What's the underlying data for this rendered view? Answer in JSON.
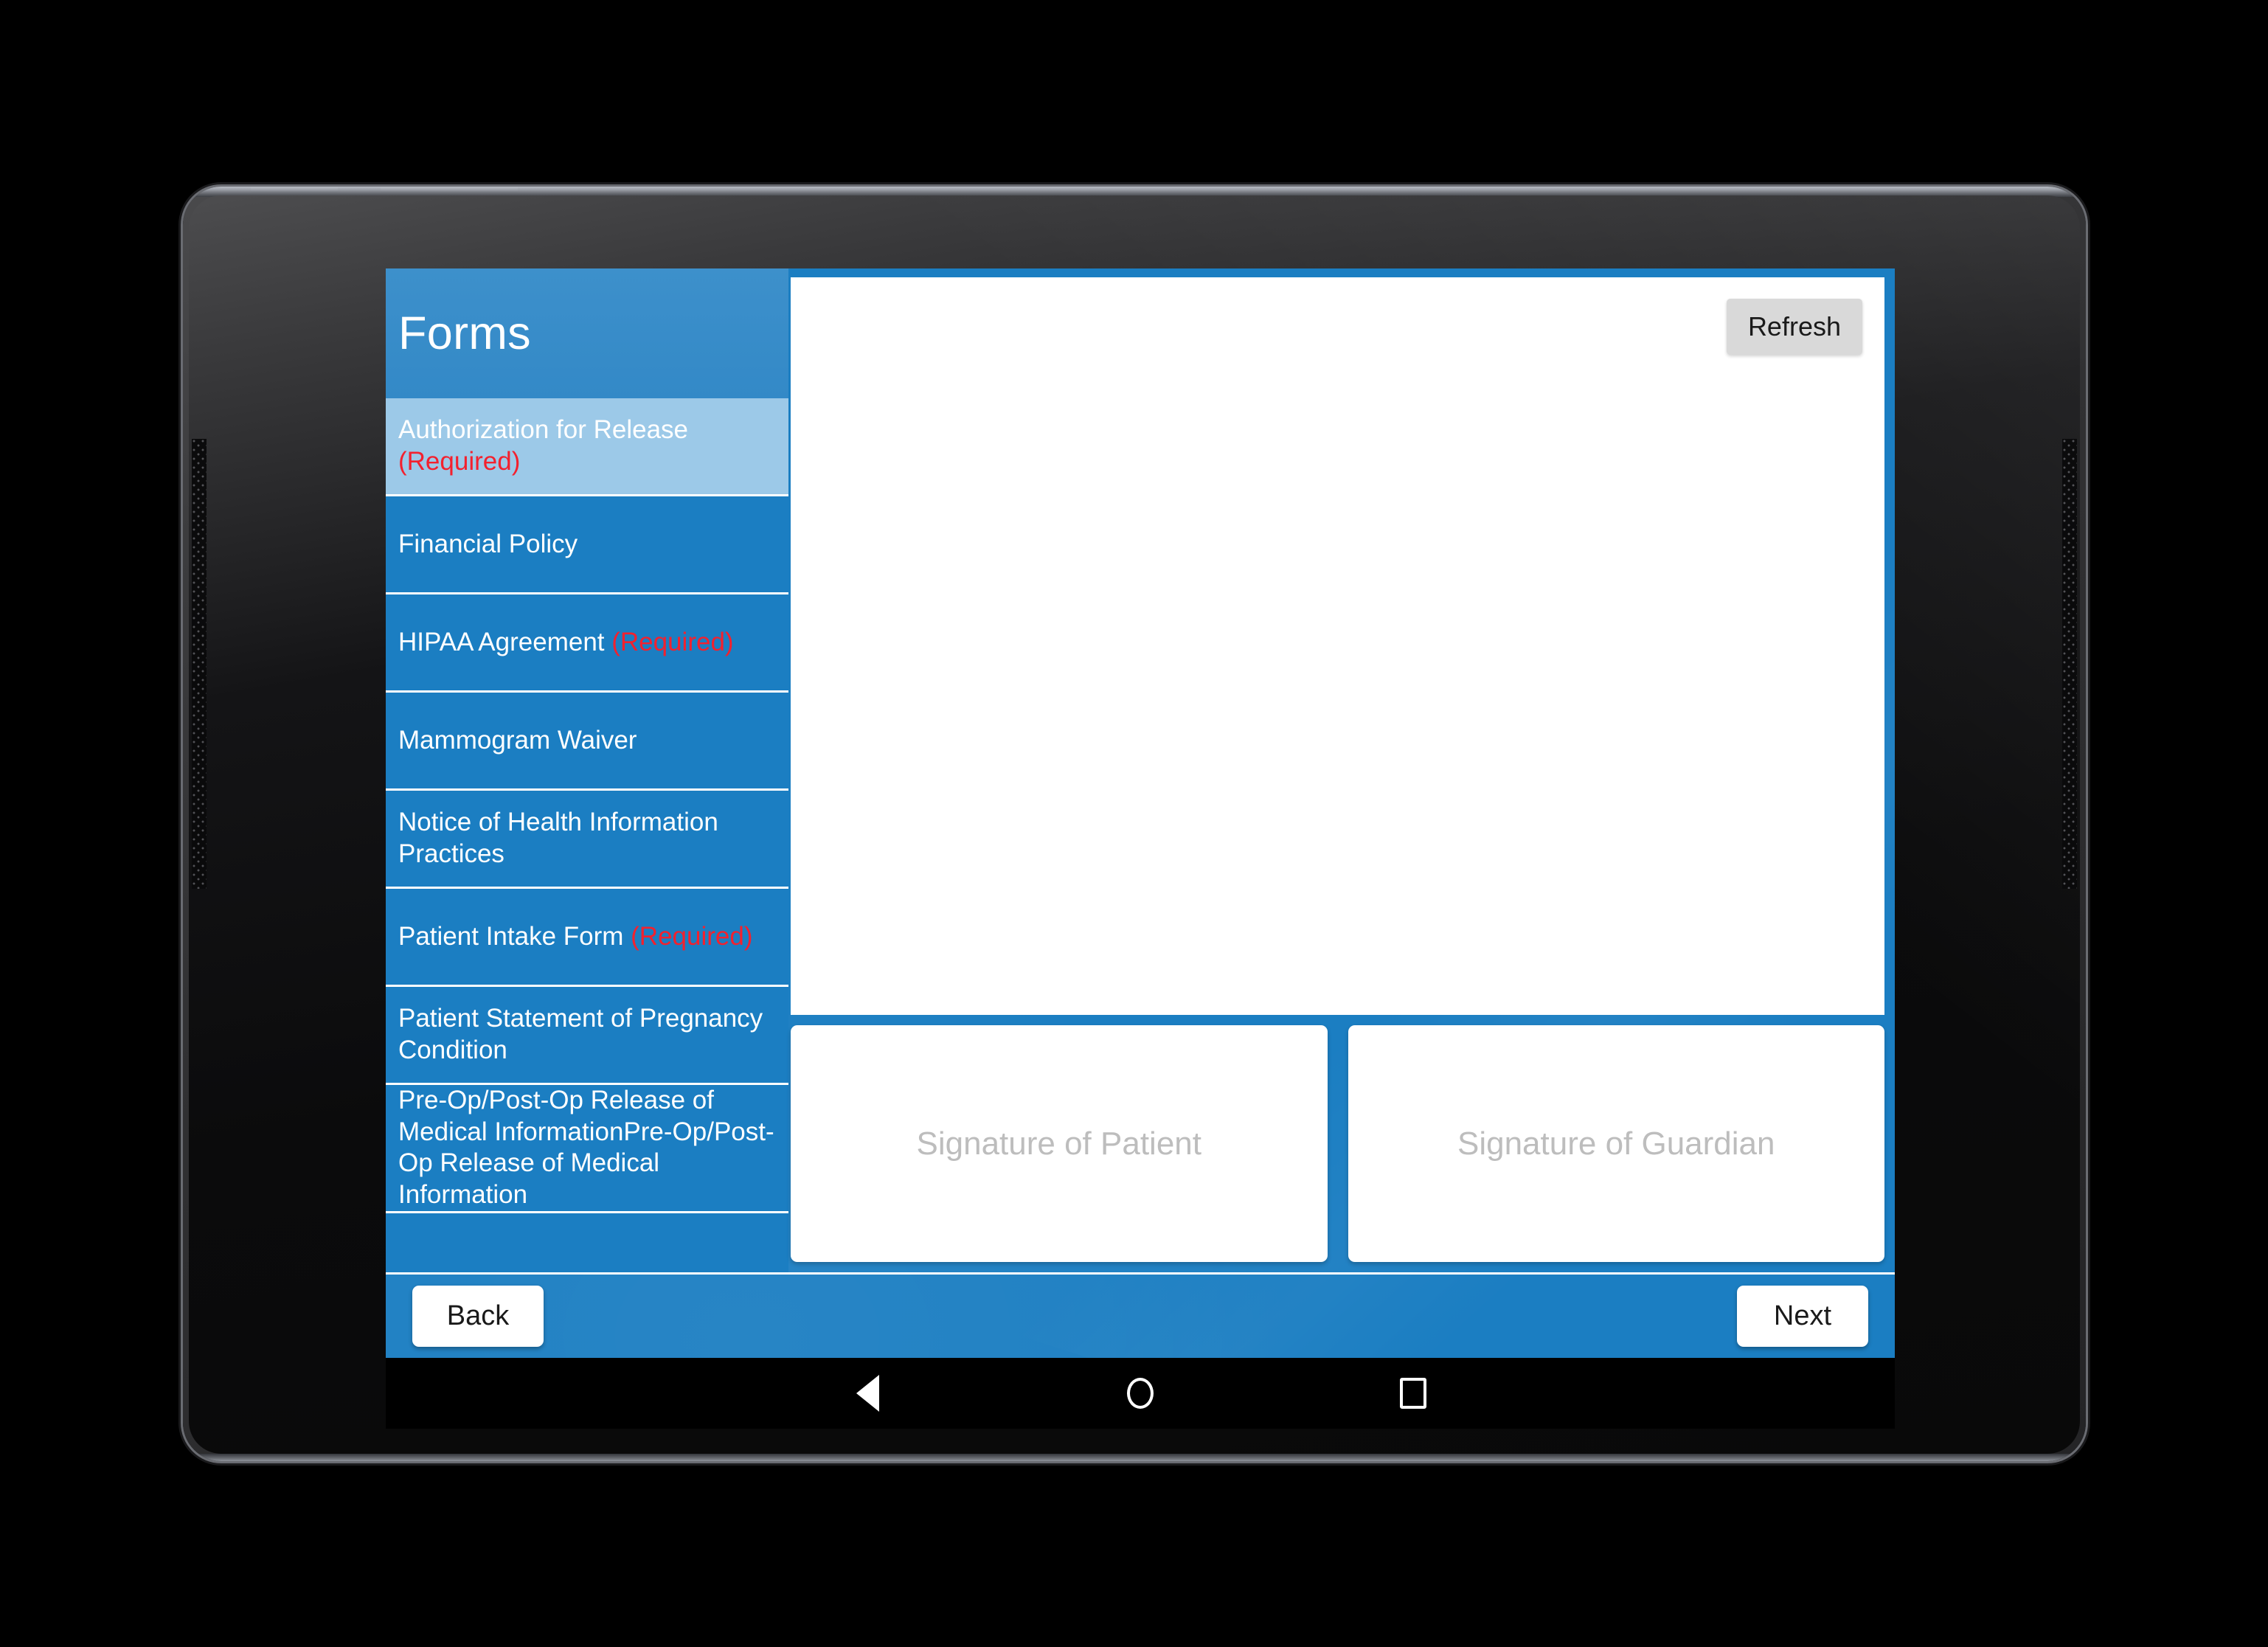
{
  "sidebar": {
    "title": "Forms",
    "items": [
      {
        "label": "Authorization for Release ",
        "required_tag": "(Required)",
        "selected": true
      },
      {
        "label": "Financial Policy",
        "required_tag": "",
        "selected": false
      },
      {
        "label": "HIPAA Agreement ",
        "required_tag": "(Required)",
        "selected": false
      },
      {
        "label": "Mammogram Waiver",
        "required_tag": "",
        "selected": false
      },
      {
        "label": "Notice of Health Information Practices",
        "required_tag": "",
        "selected": false
      },
      {
        "label": "Patient Intake Form ",
        "required_tag": "(Required)",
        "selected": false
      },
      {
        "label": "Patient Statement of Pregnancy Condition",
        "required_tag": "",
        "selected": false
      },
      {
        "label": "Pre-Op/Post-Op Release of Medical InformationPre-Op/Post-Op Release of Medical Information",
        "required_tag": "",
        "selected": false
      }
    ]
  },
  "content": {
    "refresh_label": "Refresh",
    "document_text": "",
    "signature_patient_placeholder": "Signature of Patient",
    "signature_guardian_placeholder": "Signature of Guardian"
  },
  "footer": {
    "back_label": "Back",
    "next_label": "Next"
  },
  "android_nav": {
    "back": "back-triangle-icon",
    "home": "home-circle-icon",
    "recents": "recents-square-icon"
  },
  "colors": {
    "brand_blue": "#1b7ec2",
    "header_blue": "#3389c7",
    "selected_blue": "#9cc9e8",
    "required_red": "#f3212e",
    "button_grey": "#d9d9d9",
    "placeholder_grey": "#bdbdbd"
  }
}
